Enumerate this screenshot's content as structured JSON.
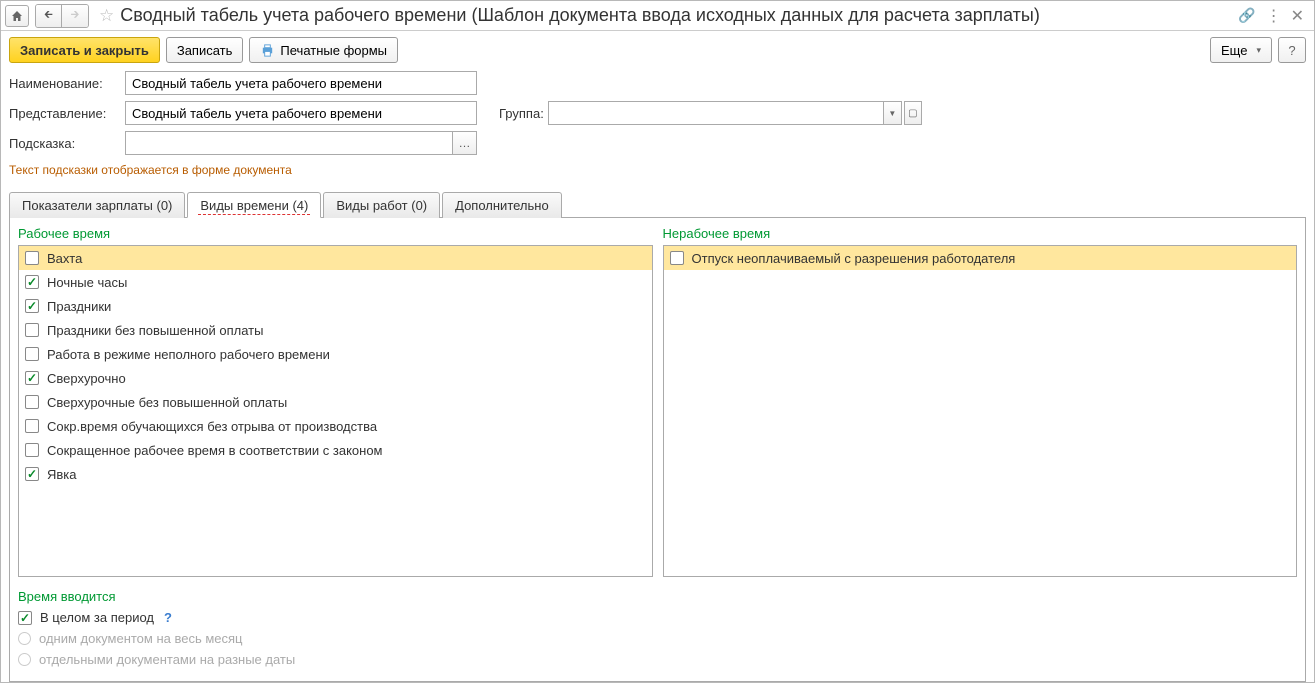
{
  "title": "Сводный табель учета рабочего времени (Шаблон документа ввода исходных данных для расчета зарплаты)",
  "cmd": {
    "save_close": "Записать и закрыть",
    "save": "Записать",
    "print": "Печатные формы",
    "more": "Еще",
    "help": "?"
  },
  "form": {
    "name_label": "Наименование:",
    "name_value": "Сводный табель учета рабочего времени",
    "repr_label": "Представление:",
    "repr_value": "Сводный табель учета рабочего времени",
    "group_label": "Группа:",
    "group_value": "",
    "hint_label": "Подсказка:",
    "hint_value": "",
    "hint_note": "Текст подсказки отображается в форме документа"
  },
  "tabs": {
    "salary": "Показатели зарплаты (0)",
    "time_types": "Виды времени (4)",
    "work_types": "Виды работ (0)",
    "extra": "Дополнительно"
  },
  "panels": {
    "working_title": "Рабочее время",
    "nonworking_title": "Нерабочее время"
  },
  "working_items": [
    {
      "label": "Вахта",
      "checked": false,
      "selected": true
    },
    {
      "label": "Ночные часы",
      "checked": true,
      "selected": false
    },
    {
      "label": "Праздники",
      "checked": true,
      "selected": false
    },
    {
      "label": "Праздники без повышенной оплаты",
      "checked": false,
      "selected": false
    },
    {
      "label": "Работа в режиме неполного рабочего времени",
      "checked": false,
      "selected": false
    },
    {
      "label": "Сверхурочно",
      "checked": true,
      "selected": false
    },
    {
      "label": "Сверхурочные без повышенной оплаты",
      "checked": false,
      "selected": false
    },
    {
      "label": "Сокр.время обучающихся без отрыва от производства",
      "checked": false,
      "selected": false
    },
    {
      "label": "Сокращенное рабочее время в соответствии с законом",
      "checked": false,
      "selected": false
    },
    {
      "label": "Явка",
      "checked": true,
      "selected": false
    }
  ],
  "nonworking_items": [
    {
      "label": "Отпуск неоплачиваемый с разрешения работодателя",
      "checked": false,
      "selected": true
    }
  ],
  "time_input": {
    "section_title": "Время вводится",
    "whole_period": "В целом за период",
    "whole_period_checked": true,
    "radio1": "одним документом на весь месяц",
    "radio2": "отдельными документами на разные даты"
  }
}
